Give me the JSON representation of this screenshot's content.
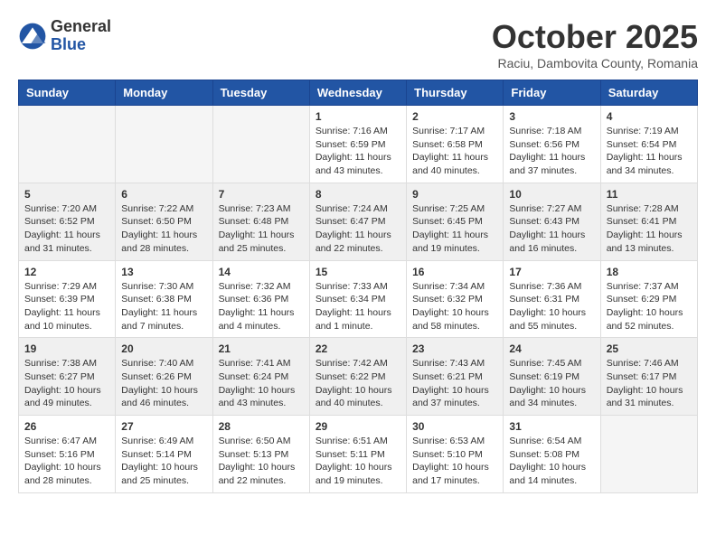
{
  "logo": {
    "general": "General",
    "blue": "Blue"
  },
  "title": "October 2025",
  "subtitle": "Raciu, Dambovita County, Romania",
  "headers": [
    "Sunday",
    "Monday",
    "Tuesday",
    "Wednesday",
    "Thursday",
    "Friday",
    "Saturday"
  ],
  "weeks": [
    [
      {
        "day": "",
        "info": ""
      },
      {
        "day": "",
        "info": ""
      },
      {
        "day": "",
        "info": ""
      },
      {
        "day": "1",
        "info": "Sunrise: 7:16 AM\nSunset: 6:59 PM\nDaylight: 11 hours and 43 minutes."
      },
      {
        "day": "2",
        "info": "Sunrise: 7:17 AM\nSunset: 6:58 PM\nDaylight: 11 hours and 40 minutes."
      },
      {
        "day": "3",
        "info": "Sunrise: 7:18 AM\nSunset: 6:56 PM\nDaylight: 11 hours and 37 minutes."
      },
      {
        "day": "4",
        "info": "Sunrise: 7:19 AM\nSunset: 6:54 PM\nDaylight: 11 hours and 34 minutes."
      }
    ],
    [
      {
        "day": "5",
        "info": "Sunrise: 7:20 AM\nSunset: 6:52 PM\nDaylight: 11 hours and 31 minutes."
      },
      {
        "day": "6",
        "info": "Sunrise: 7:22 AM\nSunset: 6:50 PM\nDaylight: 11 hours and 28 minutes."
      },
      {
        "day": "7",
        "info": "Sunrise: 7:23 AM\nSunset: 6:48 PM\nDaylight: 11 hours and 25 minutes."
      },
      {
        "day": "8",
        "info": "Sunrise: 7:24 AM\nSunset: 6:47 PM\nDaylight: 11 hours and 22 minutes."
      },
      {
        "day": "9",
        "info": "Sunrise: 7:25 AM\nSunset: 6:45 PM\nDaylight: 11 hours and 19 minutes."
      },
      {
        "day": "10",
        "info": "Sunrise: 7:27 AM\nSunset: 6:43 PM\nDaylight: 11 hours and 16 minutes."
      },
      {
        "day": "11",
        "info": "Sunrise: 7:28 AM\nSunset: 6:41 PM\nDaylight: 11 hours and 13 minutes."
      }
    ],
    [
      {
        "day": "12",
        "info": "Sunrise: 7:29 AM\nSunset: 6:39 PM\nDaylight: 11 hours and 10 minutes."
      },
      {
        "day": "13",
        "info": "Sunrise: 7:30 AM\nSunset: 6:38 PM\nDaylight: 11 hours and 7 minutes."
      },
      {
        "day": "14",
        "info": "Sunrise: 7:32 AM\nSunset: 6:36 PM\nDaylight: 11 hours and 4 minutes."
      },
      {
        "day": "15",
        "info": "Sunrise: 7:33 AM\nSunset: 6:34 PM\nDaylight: 11 hours and 1 minute."
      },
      {
        "day": "16",
        "info": "Sunrise: 7:34 AM\nSunset: 6:32 PM\nDaylight: 10 hours and 58 minutes."
      },
      {
        "day": "17",
        "info": "Sunrise: 7:36 AM\nSunset: 6:31 PM\nDaylight: 10 hours and 55 minutes."
      },
      {
        "day": "18",
        "info": "Sunrise: 7:37 AM\nSunset: 6:29 PM\nDaylight: 10 hours and 52 minutes."
      }
    ],
    [
      {
        "day": "19",
        "info": "Sunrise: 7:38 AM\nSunset: 6:27 PM\nDaylight: 10 hours and 49 minutes."
      },
      {
        "day": "20",
        "info": "Sunrise: 7:40 AM\nSunset: 6:26 PM\nDaylight: 10 hours and 46 minutes."
      },
      {
        "day": "21",
        "info": "Sunrise: 7:41 AM\nSunset: 6:24 PM\nDaylight: 10 hours and 43 minutes."
      },
      {
        "day": "22",
        "info": "Sunrise: 7:42 AM\nSunset: 6:22 PM\nDaylight: 10 hours and 40 minutes."
      },
      {
        "day": "23",
        "info": "Sunrise: 7:43 AM\nSunset: 6:21 PM\nDaylight: 10 hours and 37 minutes."
      },
      {
        "day": "24",
        "info": "Sunrise: 7:45 AM\nSunset: 6:19 PM\nDaylight: 10 hours and 34 minutes."
      },
      {
        "day": "25",
        "info": "Sunrise: 7:46 AM\nSunset: 6:17 PM\nDaylight: 10 hours and 31 minutes."
      }
    ],
    [
      {
        "day": "26",
        "info": "Sunrise: 6:47 AM\nSunset: 5:16 PM\nDaylight: 10 hours and 28 minutes."
      },
      {
        "day": "27",
        "info": "Sunrise: 6:49 AM\nSunset: 5:14 PM\nDaylight: 10 hours and 25 minutes."
      },
      {
        "day": "28",
        "info": "Sunrise: 6:50 AM\nSunset: 5:13 PM\nDaylight: 10 hours and 22 minutes."
      },
      {
        "day": "29",
        "info": "Sunrise: 6:51 AM\nSunset: 5:11 PM\nDaylight: 10 hours and 19 minutes."
      },
      {
        "day": "30",
        "info": "Sunrise: 6:53 AM\nSunset: 5:10 PM\nDaylight: 10 hours and 17 minutes."
      },
      {
        "day": "31",
        "info": "Sunrise: 6:54 AM\nSunset: 5:08 PM\nDaylight: 10 hours and 14 minutes."
      },
      {
        "day": "",
        "info": ""
      }
    ]
  ]
}
